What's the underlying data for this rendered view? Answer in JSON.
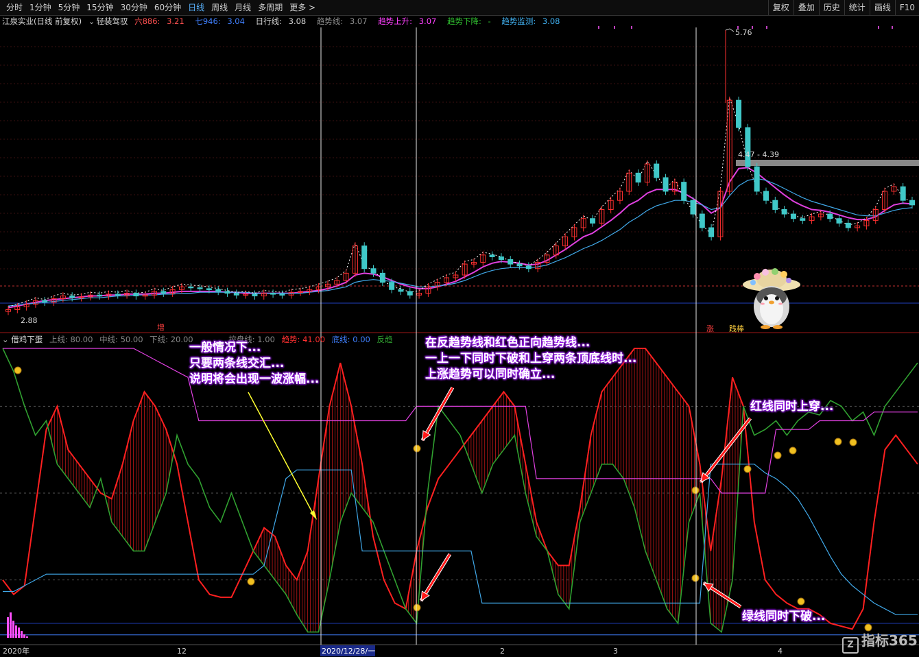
{
  "toolbar": {
    "tabs": [
      "分时",
      "1分钟",
      "5分钟",
      "15分钟",
      "30分钟",
      "60分钟",
      "日线",
      "周线",
      "月线",
      "多周期",
      "更多 >"
    ],
    "active_tab": "日线",
    "tools": [
      "复权",
      "叠加",
      "历史",
      "统计",
      "画线",
      "F10"
    ]
  },
  "infobar": {
    "stock": "江泉实业(日线 前复权)",
    "indicator": "轻装驾驭",
    "six_label": "六886:",
    "six_value": "3.21",
    "seven_label": "七946:",
    "seven_value": "3.04",
    "day_label": "日行线:",
    "day_value": "3.08",
    "trend_label": "趋势线:",
    "trend_value": "3.07",
    "up_label": "趋势上升:",
    "up_value": "3.07",
    "down_label": "趋势下降:",
    "down_value": "-",
    "monitor_label": "趋势监测:",
    "monitor_value": "3.08"
  },
  "lower_info": {
    "name": "借鸡下蛋",
    "upper": "上线: 80.00",
    "middle": "中线: 50.00",
    "lower": "下线: 20.00",
    "extra1": "控盘线: 1.00",
    "trend": "趋势: 41.00",
    "bottom": "底线: 0.00",
    "reverse": "反趋"
  },
  "markers": {
    "zeng": "增",
    "zhang": "涨",
    "jiantao": "践棒"
  },
  "annotations": {
    "left": [
      "一般情况下...",
      "只要两条线交汇...",
      "说明将会出现一波涨幅..."
    ],
    "right": [
      "在反趋势线和红色正向趋势线...",
      "一上一下同时下破和上穿两条顶底线时...",
      "上涨趋势可以同时确立..."
    ],
    "red_cross": "红线同时上穿...",
    "green_break": "绿线同时下破..."
  },
  "axis": {
    "year": "2020年",
    "m12": "12",
    "crosshair_date": "2020/12/28/一",
    "m2": "2",
    "m3": "3",
    "m4": "4"
  },
  "logo": "指标365",
  "colors": {
    "up": "#ff3030",
    "down": "#40c8c8",
    "red_line": "#ff2020",
    "green_line": "#30a030",
    "magenta": "#e040e0",
    "blue_line": "#40a8e8"
  },
  "chart_data": [
    {
      "type": "candlestick",
      "title": "江泉实业(日线 前复权)",
      "labels": {
        "high": "5.76",
        "low": "2.88",
        "range": "4.47 - 4.39"
      },
      "ylim": [
        2.7,
        6.0
      ],
      "close": [
        2.9,
        2.93,
        2.96,
        3.0,
        2.98,
        3.02,
        3.05,
        3.03,
        3.04,
        3.06,
        3.05,
        3.07,
        3.06,
        3.08,
        3.05,
        3.06,
        3.1,
        3.08,
        3.12,
        3.15,
        3.14,
        3.13,
        3.12,
        3.1,
        3.08,
        3.06,
        3.07,
        3.05,
        3.08,
        3.07,
        3.06,
        3.09,
        3.1,
        3.12,
        3.15,
        3.18,
        3.22,
        3.3,
        3.6,
        3.35,
        3.3,
        3.2,
        3.12,
        3.1,
        3.06,
        3.08,
        3.15,
        3.2,
        3.25,
        3.28,
        3.4,
        3.42,
        3.5,
        3.48,
        3.45,
        3.4,
        3.38,
        3.35,
        3.42,
        3.5,
        3.6,
        3.7,
        3.8,
        3.9,
        3.85,
        4.0,
        4.1,
        4.2,
        4.4,
        4.3,
        4.5,
        4.35,
        4.2,
        4.3,
        4.1,
        3.95,
        3.8,
        3.7,
        4.2,
        5.2,
        4.9,
        4.47,
        4.2,
        4.1,
        4.0,
        3.95,
        3.9,
        3.88,
        3.92,
        3.95,
        3.9,
        3.85,
        3.8,
        3.82,
        3.88,
        4.0,
        4.2,
        4.25,
        4.1,
        4.05
      ],
      "series": [
        {
          "name": "趋势上升",
          "values": [
            2.92,
            2.94,
            2.96,
            2.98,
            3.0,
            3.01,
            3.02,
            3.03,
            3.04,
            3.05,
            3.05,
            3.06,
            3.06,
            3.07,
            3.07,
            3.07,
            3.08,
            3.08,
            3.09,
            3.1,
            3.1,
            3.1,
            3.1,
            3.1,
            3.09,
            3.09,
            3.08,
            3.08,
            3.08,
            3.08,
            3.08,
            3.08,
            3.09,
            3.1,
            3.11,
            3.13,
            3.16,
            3.2,
            3.28,
            3.3,
            3.29,
            3.26,
            3.22,
            3.18,
            3.15,
            3.13,
            3.13,
            3.15,
            3.18,
            3.21,
            3.26,
            3.31,
            3.37,
            3.41,
            3.43,
            3.42,
            3.41,
            3.39,
            3.4,
            3.44,
            3.5,
            3.56,
            3.63,
            3.7,
            3.74,
            3.81,
            3.88,
            3.96,
            4.05,
            4.1,
            4.18,
            4.22,
            4.22,
            4.22,
            4.18,
            4.12,
            4.05,
            3.96,
            4.02,
            4.3,
            4.45,
            4.46,
            4.4,
            4.32,
            4.24,
            4.16,
            4.09,
            4.04,
            4.0,
            3.99,
            3.97,
            3.94,
            3.91,
            3.89,
            3.89,
            3.92,
            3.99,
            4.05,
            4.07,
            4.06
          ]
        },
        {
          "name": "趋势监测",
          "values": [
            2.94,
            2.95,
            2.96,
            2.97,
            2.98,
            2.99,
            3.0,
            3.01,
            3.02,
            3.03,
            3.03,
            3.04,
            3.05,
            3.05,
            3.06,
            3.06,
            3.06,
            3.07,
            3.07,
            3.08,
            3.08,
            3.09,
            3.09,
            3.09,
            3.09,
            3.09,
            3.09,
            3.08,
            3.08,
            3.08,
            3.08,
            3.08,
            3.08,
            3.09,
            3.1,
            3.11,
            3.13,
            3.15,
            3.2,
            3.22,
            3.23,
            3.22,
            3.21,
            3.19,
            3.17,
            3.15,
            3.15,
            3.16,
            3.17,
            3.19,
            3.22,
            3.26,
            3.3,
            3.33,
            3.35,
            3.36,
            3.36,
            3.36,
            3.37,
            3.39,
            3.43,
            3.47,
            3.52,
            3.57,
            3.61,
            3.66,
            3.72,
            3.78,
            3.86,
            3.92,
            3.99,
            4.04,
            4.07,
            4.1,
            4.1,
            4.08,
            4.05,
            4.0,
            4.02,
            4.15,
            4.26,
            4.32,
            4.34,
            4.32,
            4.28,
            4.23,
            4.18,
            4.13,
            4.09,
            4.06,
            4.03,
            4.0,
            3.97,
            3.94,
            3.93,
            3.93,
            3.96,
            3.99,
            4.01,
            4.02
          ]
        }
      ]
    },
    {
      "type": "line",
      "title": "借鸡下蛋",
      "ylim": [
        0,
        100
      ],
      "levels": [
        80,
        50,
        20
      ],
      "series": [
        {
          "name": "趋势",
          "values": [
            20,
            15,
            18,
            45,
            72,
            80,
            65,
            60,
            55,
            50,
            48,
            60,
            75,
            85,
            80,
            72,
            60,
            40,
            20,
            15,
            14,
            14,
            22,
            30,
            38,
            35,
            25,
            20,
            30,
            55,
            80,
            95,
            80,
            60,
            35,
            20,
            12,
            10,
            30,
            45,
            55,
            60,
            65,
            70,
            75,
            80,
            85,
            80,
            60,
            40,
            30,
            25,
            25,
            45,
            70,
            85,
            90,
            95,
            100,
            100,
            95,
            90,
            85,
            80,
            60,
            30,
            55,
            90,
            80,
            40,
            20,
            15,
            12,
            10,
            10,
            8,
            5,
            4,
            3,
            10,
            40,
            65,
            70,
            65,
            60
          ]
        },
        {
          "name": "反趋",
          "values": [
            100,
            92,
            80,
            70,
            75,
            60,
            55,
            50,
            45,
            55,
            40,
            35,
            30,
            30,
            40,
            50,
            70,
            60,
            55,
            45,
            40,
            50,
            40,
            30,
            25,
            20,
            15,
            8,
            2,
            2,
            20,
            40,
            50,
            45,
            40,
            30,
            20,
            10,
            5,
            50,
            80,
            75,
            70,
            60,
            50,
            60,
            65,
            70,
            50,
            35,
            30,
            15,
            10,
            40,
            50,
            60,
            60,
            55,
            45,
            30,
            20,
            10,
            5,
            40,
            50,
            5,
            2,
            20,
            80,
            70,
            72,
            75,
            70,
            75,
            78,
            77,
            82,
            80,
            75,
            78,
            70,
            80,
            85,
            90,
            95
          ]
        },
        {
          "name": "顶线",
          "values": [
            100,
            100,
            100,
            100,
            100,
            100,
            100,
            100,
            100,
            100,
            100,
            100,
            100,
            98,
            96,
            94,
            92,
            90,
            75,
            75,
            75,
            75,
            75,
            75,
            75,
            75,
            75,
            75,
            75,
            75,
            75,
            75,
            75,
            75,
            75,
            75,
            75,
            75,
            80,
            80,
            80,
            80,
            80,
            80,
            80,
            80,
            80,
            80,
            80,
            55,
            55,
            55,
            55,
            55,
            55,
            55,
            55,
            55,
            55,
            55,
            55,
            55,
            55,
            55,
            55,
            55,
            50,
            50,
            50,
            50,
            50,
            72,
            72,
            72,
            72,
            75,
            75,
            75,
            75,
            75,
            78,
            78,
            78,
            78,
            78
          ]
        },
        {
          "name": "底线",
          "values": [
            16,
            16,
            18,
            20,
            22,
            22,
            22,
            22,
            22,
            22,
            22,
            22,
            22,
            22,
            22,
            22,
            22,
            22,
            22,
            22,
            22,
            22,
            22,
            22,
            25,
            40,
            55,
            58,
            58,
            58,
            58,
            58,
            58,
            30,
            30,
            30,
            30,
            30,
            30,
            30,
            30,
            30,
            30,
            30,
            12,
            12,
            12,
            12,
            12,
            12,
            12,
            12,
            12,
            12,
            12,
            12,
            12,
            12,
            12,
            12,
            12,
            12,
            12,
            12,
            12,
            60,
            60,
            60,
            60,
            60,
            57,
            55,
            52,
            48,
            42,
            35,
            28,
            22,
            18,
            15,
            12,
            10,
            8,
            8,
            8
          ]
        }
      ]
    }
  ]
}
